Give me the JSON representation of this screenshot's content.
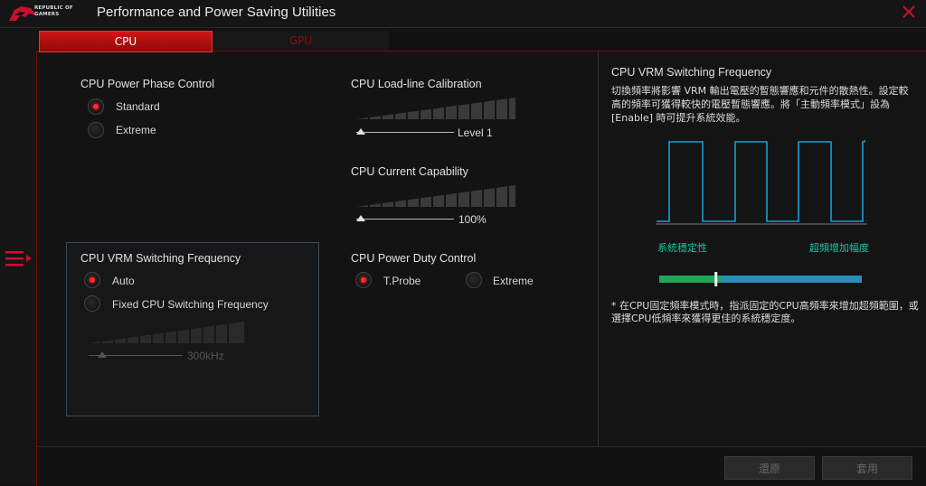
{
  "window": {
    "title": "Performance and Power Saving Utilities",
    "logo_text_line1": "REPUBLIC OF",
    "logo_text_line2": "GAMERS",
    "close_icon": "close-icon",
    "menu_icon": "hamburger-menu-icon"
  },
  "tabs": [
    {
      "label": "CPU",
      "active": true
    },
    {
      "label": "GPU",
      "active": false
    }
  ],
  "phase_control": {
    "title": "CPU Power Phase Control",
    "options": [
      {
        "label": "Standard",
        "selected": true
      },
      {
        "label": "Extreme",
        "selected": false
      }
    ]
  },
  "loadline": {
    "title": "CPU Load-line Calibration",
    "value": "Level 1",
    "level_fraction": 0.0
  },
  "current_capability": {
    "title": "CPU Current Capability",
    "value": "100%",
    "level_fraction": 0.0
  },
  "vrm_switching": {
    "title": "CPU VRM Switching Frequency",
    "options": [
      {
        "label": "Auto",
        "selected": true
      },
      {
        "label": "Fixed CPU Switching Frequency",
        "selected": false
      }
    ],
    "value": "300kHz",
    "level_fraction": 0.1
  },
  "duty_control": {
    "title": "CPU Power Duty Control",
    "options": [
      {
        "label": "T.Probe",
        "selected": true
      },
      {
        "label": "Extreme",
        "selected": false
      }
    ]
  },
  "info_panel": {
    "title": "CPU VRM Switching Frequency",
    "description": "切換頻率將影響 VRM 輸出電壓的暫態響應和元件的散熱性。設定較高的頻率可獲得較快的電壓暫態響應。將「主動頻率模式」設為 [Enable] 時可提升系統效能。",
    "low_label": "系統穩定性",
    "high_label": "超頻增加幅度",
    "note": "* 在CPU固定頻率模式時，指派固定的CPU高頻率來增加超頻範圍，或選擇CPU低頻率來獲得更佳的系統穩定度。",
    "scale_position": 0.28,
    "colors": {
      "wave": "#1e9bd0",
      "scale_low": "#1fa85a",
      "scale_high": "#2a8fb8"
    }
  },
  "buttons": {
    "undo": "還原",
    "apply": "套用"
  },
  "colors": {
    "accent": "#c8102e",
    "teal": "#14c9a0"
  }
}
